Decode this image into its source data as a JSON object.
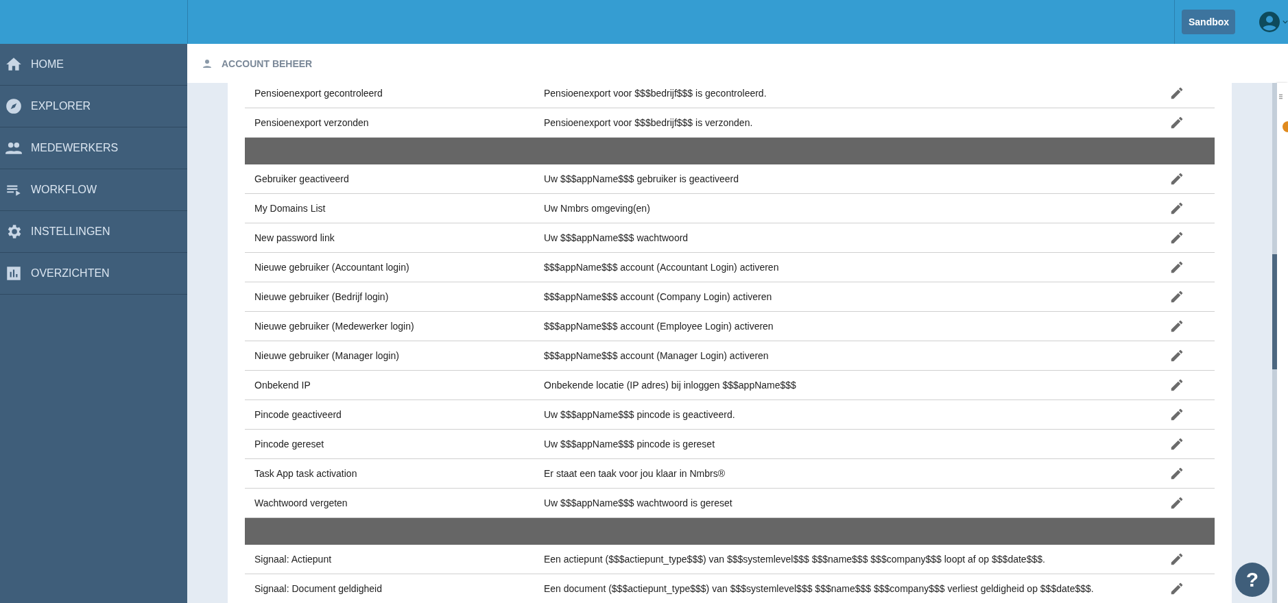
{
  "topbar": {
    "environment_button": "Sandbox"
  },
  "sidebar": {
    "items": [
      {
        "label": "HOME",
        "kind": "home"
      },
      {
        "label": "EXPLORER",
        "kind": "compass"
      },
      {
        "label": "MEDEWERKERS",
        "kind": "people"
      },
      {
        "label": "WORKFLOW",
        "kind": "list"
      },
      {
        "label": "INSTELLINGEN",
        "kind": "gear"
      },
      {
        "label": "OVERZICHTEN",
        "kind": "chart"
      }
    ]
  },
  "page_header": {
    "title": "ACCOUNT BEHEER"
  },
  "table": {
    "groups": [
      {
        "rows": [
          {
            "name": "Pensioenexport gecontroleerd",
            "subject": "Pensioenexport voor $$$bedrijf$$$ is gecontroleerd."
          },
          {
            "name": "Pensioenexport verzonden",
            "subject": "Pensioenexport voor $$$bedrijf$$$ is verzonden."
          }
        ]
      },
      {
        "rows": [
          {
            "name": "Gebruiker geactiveerd",
            "subject": "Uw $$$appName$$$ gebruiker is geactiveerd"
          },
          {
            "name": "My Domains List",
            "subject": "Uw Nmbrs omgeving(en)"
          },
          {
            "name": "New password link",
            "subject": "Uw $$$appName$$$ wachtwoord"
          },
          {
            "name": "Nieuwe gebruiker (Accountant login)",
            "subject": "$$$appName$$$ account (Accountant Login) activeren"
          },
          {
            "name": "Nieuwe gebruiker (Bedrijf login)",
            "subject": "$$$appName$$$ account (Company Login) activeren"
          },
          {
            "name": "Nieuwe gebruiker (Medewerker login)",
            "subject": "$$$appName$$$ account (Employee Login) activeren"
          },
          {
            "name": "Nieuwe gebruiker (Manager login)",
            "subject": "$$$appName$$$ account (Manager Login) activeren"
          },
          {
            "name": "Onbekend IP",
            "subject": "Onbekende locatie (IP adres) bij inloggen $$$appName$$$"
          },
          {
            "name": "Pincode geactiveerd",
            "subject": "Uw $$$appName$$$ pincode is geactiveerd."
          },
          {
            "name": "Pincode gereset",
            "subject": "Uw $$$appName$$$ pincode is gereset"
          },
          {
            "name": "Task App task activation",
            "subject": "Er staat een taak voor jou klaar in Nmbrs®"
          },
          {
            "name": "Wachtwoord vergeten",
            "subject": "Uw $$$appName$$$ wachtwoord is gereset"
          }
        ]
      },
      {
        "rows": [
          {
            "name": "Signaal: Actiepunt",
            "subject": "Een actiepunt ($$$actiepunt_type$$$) van $$$systemlevel$$$ $$$name$$$ $$$company$$$ loopt af op $$$date$$$."
          },
          {
            "name": "Signaal: Document geldigheid",
            "subject": "Een document ($$$actiepunt_type$$$) van $$$systemlevel$$$ $$$name$$$ $$$company$$$ verliest geldigheid op $$$date$$$."
          }
        ]
      }
    ]
  },
  "help_button": "?"
}
